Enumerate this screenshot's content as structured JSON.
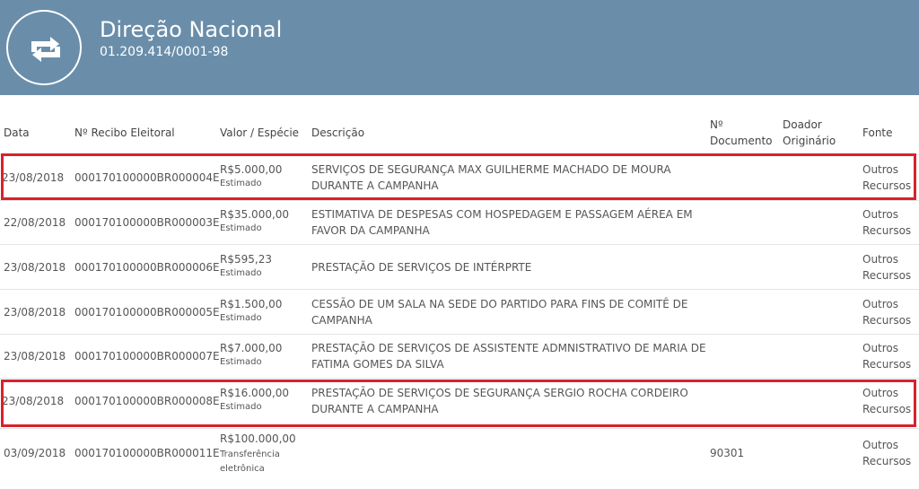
{
  "header": {
    "title": "Direção Nacional",
    "subtitle": "01.209.414/0001-98",
    "icon": "retweet-icon"
  },
  "columns": {
    "data": "Data",
    "recibo": "Nº Recibo Eleitoral",
    "valor": "Valor / Espécie",
    "descricao": "Descrição",
    "documento_line1": "Nº",
    "documento_line2": "Documento",
    "doador_line1": "Doador",
    "doador_line2": "Originário",
    "fonte": "Fonte"
  },
  "rows": [
    {
      "data": "23/08/2018",
      "recibo": "000170100000BR000004E",
      "valor": "R$5.000,00",
      "especie": "Estimado",
      "descricao_l1": "SERVIÇOS DE SEGURANÇA MAX GUILHERME MACHADO DE MOURA",
      "descricao_l2": "DURANTE A CAMPANHA",
      "documento": "",
      "fonte_l1": "Outros",
      "fonte_l2": "Recursos",
      "highlighted": true
    },
    {
      "data": "22/08/2018",
      "recibo": "000170100000BR000003E",
      "valor": "R$35.000,00",
      "especie": "Estimado",
      "descricao_l1": "ESTIMATIVA DE DESPESAS COM HOSPEDAGEM E PASSAGEM AÉREA EM",
      "descricao_l2": "FAVOR DA CAMPANHA",
      "documento": "",
      "fonte_l1": "Outros",
      "fonte_l2": "Recursos",
      "highlighted": false
    },
    {
      "data": "23/08/2018",
      "recibo": "000170100000BR000006E",
      "valor": "R$595,23",
      "especie": "Estimado",
      "descricao_l1": "PRESTAÇÃO DE SERVIÇOS DE INTÉRPRTE",
      "descricao_l2": "",
      "documento": "",
      "fonte_l1": "Outros",
      "fonte_l2": "Recursos",
      "highlighted": false
    },
    {
      "data": "23/08/2018",
      "recibo": "000170100000BR000005E",
      "valor": "R$1.500,00",
      "especie": "Estimado",
      "descricao_l1": "CESSÃO DE UM SALA NA SEDE DO PARTIDO PARA FINS DE COMITÊ DE",
      "descricao_l2": "CAMPANHA",
      "documento": "",
      "fonte_l1": "Outros",
      "fonte_l2": "Recursos",
      "highlighted": false
    },
    {
      "data": "23/08/2018",
      "recibo": "000170100000BR000007E",
      "valor": "R$7.000,00",
      "especie": "Estimado",
      "descricao_l1": "PRESTAÇÃO DE SERVIÇOS DE ASSISTENTE ADMNISTRATIVO DE MARIA DE",
      "descricao_l2": "FATIMA GOMES DA SILVA",
      "documento": "",
      "fonte_l1": "Outros",
      "fonte_l2": "Recursos",
      "highlighted": false
    },
    {
      "data": "23/08/2018",
      "recibo": "000170100000BR000008E",
      "valor": "R$16.000,00",
      "especie": "Estimado",
      "descricao_l1": "PRESTAÇÃO DE SERVIÇOS DE SEGURANÇA SERGIO ROCHA CORDEIRO",
      "descricao_l2": "DURANTE A CAMPANHA",
      "documento": "",
      "fonte_l1": "Outros",
      "fonte_l2": "Recursos",
      "highlighted": true
    },
    {
      "data": "03/09/2018",
      "recibo": "000170100000BR000011E",
      "valor": "R$100.000,00",
      "especie_l1": "Transferência",
      "especie_l2": "eletrônica",
      "descricao_l1": "",
      "descricao_l2": "",
      "documento": "90301",
      "fonte_l1": "Outros",
      "fonte_l2": "Recursos",
      "highlighted": false
    }
  ],
  "colors": {
    "header_bg": "#6a8eaa",
    "highlight_border": "#d8222c",
    "text": "#555555"
  }
}
